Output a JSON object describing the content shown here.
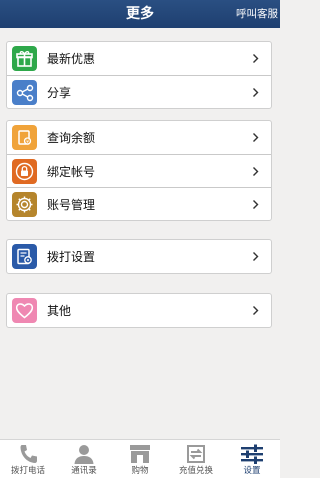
{
  "header": {
    "title": "更多",
    "service_label": "呼叫客服"
  },
  "groups": [
    {
      "items": [
        {
          "label": "最新优惠",
          "icon": "gift-icon",
          "color": "#2ea84a"
        },
        {
          "label": "分享",
          "icon": "share-icon",
          "color": "#4a7fc9"
        }
      ]
    },
    {
      "items": [
        {
          "label": "查询余额",
          "icon": "balance-icon",
          "color": "#f0a33a"
        },
        {
          "label": "绑定帐号",
          "icon": "lock-icon",
          "color": "#e06a22"
        },
        {
          "label": "账号管理",
          "icon": "gear-icon",
          "color": "#b5852c"
        }
      ]
    },
    {
      "items": [
        {
          "label": "拨打设置",
          "icon": "phone-settings-icon",
          "color": "#2a5aa8"
        }
      ]
    },
    {
      "items": [
        {
          "label": "其他",
          "icon": "heart-icon",
          "color": "#ef88b2"
        }
      ]
    }
  ],
  "tabs": [
    {
      "label": "拨打电话",
      "icon": "phone-icon"
    },
    {
      "label": "通讯录",
      "icon": "contacts-icon"
    },
    {
      "label": "购物",
      "icon": "shop-icon"
    },
    {
      "label": "充值兑换",
      "icon": "exchange-icon"
    },
    {
      "label": "设置",
      "icon": "settings-sliders-icon",
      "active": true
    }
  ],
  "colors": {
    "header": "#1e3f70",
    "background": "#f1f0ef",
    "tab_icon": "#9a9a9a",
    "tab_active": "#1e3f70"
  }
}
